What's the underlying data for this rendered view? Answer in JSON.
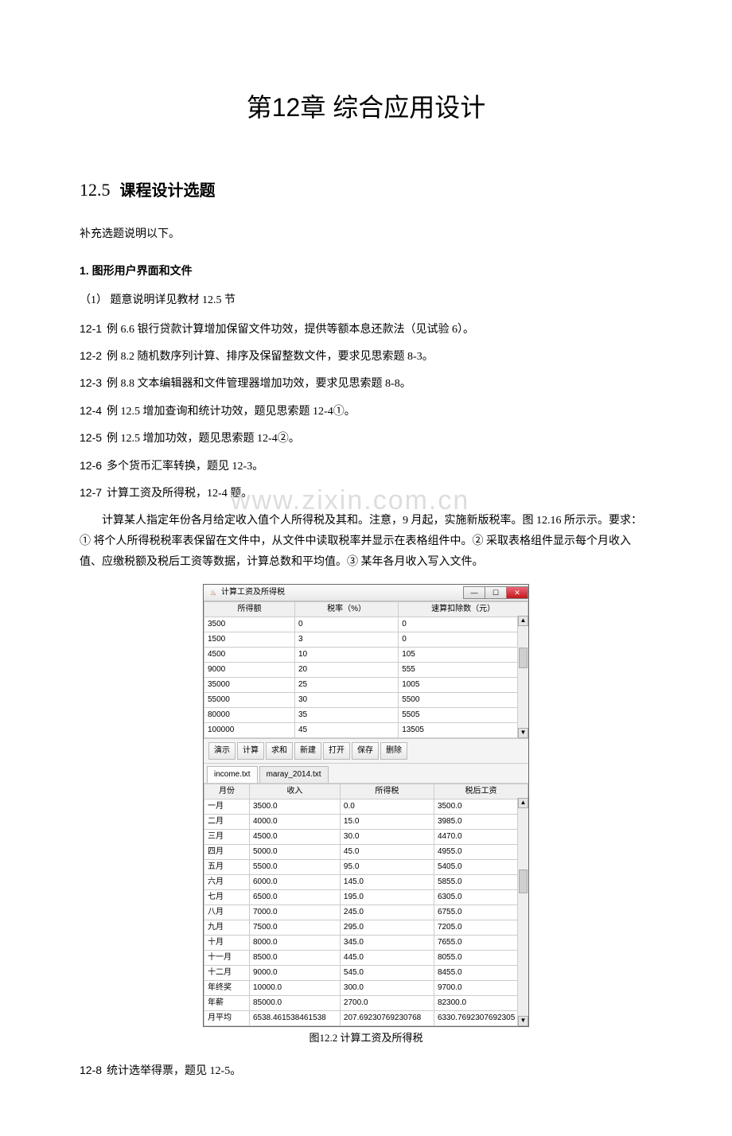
{
  "chapter_title": "第12章  综合应用设计",
  "section": {
    "number": "12.5",
    "title": "课程设计选题"
  },
  "intro": "补充选题说明以下。",
  "subhead": "1.  图形用户界面和文件",
  "sub_explain": "（1） 题意说明详见教材 12.5 节",
  "items": [
    {
      "num": "12-1",
      "text": "例 6.6 银行贷款计算增加保留文件功效，提供等额本息还款法（见试验 6）。"
    },
    {
      "num": "12-2",
      "text": "例 8.2 随机数序列计算、排序及保留整数文件，要求见思索题 8-3。"
    },
    {
      "num": "12-3",
      "text": "例 8.8 文本编辑器和文件管理器增加功效，要求见思索题 8-8。"
    },
    {
      "num": "12-4",
      "text": "例 12.5 增加查询和统计功效，题见思索题 12-4①。"
    },
    {
      "num": "12-5",
      "text": "例 12.5 增加功效，题见思索题 12-4②。"
    },
    {
      "num": "12-6",
      "text": "多个货币汇率转换，题见 12-3。"
    },
    {
      "num": "12-7",
      "text": "计算工资及所得税，12-4 题。"
    }
  ],
  "paragraph": "计算某人指定年份各月给定收入值个人所得税及其和。注意，9 月起，实施新版税率。图 12.16 所示示。要求：① 将个人所得税税率表保留在文件中，从文件中读取税率并显示在表格组件中。② 采取表格组件显示每个月收入值、应缴税额及税后工资等数据，计算总数和平均值。③ 某年各月收入写入文件。",
  "watermark": "www.zixin.com.cn",
  "app": {
    "title": "计算工资及所得税",
    "tax_headers": [
      "所得额",
      "税率（%）",
      "速算扣除数（元）"
    ],
    "tax_rows": [
      [
        "3500",
        "0",
        "0"
      ],
      [
        "1500",
        "3",
        "0"
      ],
      [
        "4500",
        "10",
        "105"
      ],
      [
        "9000",
        "20",
        "555"
      ],
      [
        "35000",
        "25",
        "1005"
      ],
      [
        "55000",
        "30",
        "5500"
      ],
      [
        "80000",
        "35",
        "5505"
      ],
      [
        "100000",
        "45",
        "13505"
      ]
    ],
    "toolbar": [
      "演示",
      "计算",
      "求和",
      "新建",
      "打开",
      "保存",
      "删除"
    ],
    "tabs": [
      "income.txt",
      "maray_2014.txt"
    ],
    "income_headers": [
      "月份",
      "收入",
      "所得税",
      "税后工资"
    ],
    "income_rows": [
      [
        "一月",
        "3500.0",
        "0.0",
        "3500.0"
      ],
      [
        "二月",
        "4000.0",
        "15.0",
        "3985.0"
      ],
      [
        "三月",
        "4500.0",
        "30.0",
        "4470.0"
      ],
      [
        "四月",
        "5000.0",
        "45.0",
        "4955.0"
      ],
      [
        "五月",
        "5500.0",
        "95.0",
        "5405.0"
      ],
      [
        "六月",
        "6000.0",
        "145.0",
        "5855.0"
      ],
      [
        "七月",
        "6500.0",
        "195.0",
        "6305.0"
      ],
      [
        "八月",
        "7000.0",
        "245.0",
        "6755.0"
      ],
      [
        "九月",
        "7500.0",
        "295.0",
        "7205.0"
      ],
      [
        "十月",
        "8000.0",
        "345.0",
        "7655.0"
      ],
      [
        "十一月",
        "8500.0",
        "445.0",
        "8055.0"
      ],
      [
        "十二月",
        "9000.0",
        "545.0",
        "8455.0"
      ],
      [
        "年终奖",
        "10000.0",
        "300.0",
        "9700.0"
      ],
      [
        "年薪",
        "85000.0",
        "2700.0",
        "82300.0"
      ],
      [
        "月平均",
        "6538.461538461538",
        "207.69230769230768",
        "6330.7692307692305"
      ]
    ]
  },
  "figure_caption": "图12.2  计算工资及所得税",
  "item_last": {
    "num": "12-8",
    "text": "统计选举得票，题见 12-5。"
  }
}
